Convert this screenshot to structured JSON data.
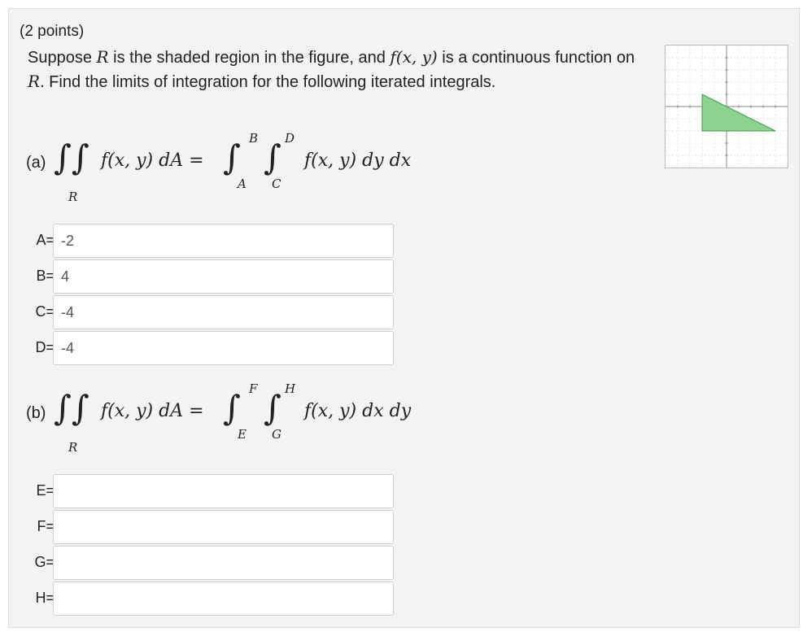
{
  "points": "(2 points)",
  "prompt": {
    "t1": "Suppose ",
    "r1": "R",
    "t2": " is the shaded region in the figure, and ",
    "fxy": "f(x, y)",
    "t3": " is a continuous function on ",
    "r2": "R",
    "t4": ". Find the limits of integration for the following iterated integrals."
  },
  "part_a": {
    "label": "(a)",
    "region": "R",
    "lhs": "f(x, y) dA =",
    "upper_outer": "B",
    "lower_outer": "A",
    "upper_inner": "D",
    "lower_inner": "C",
    "rhs": "f(x, y) dy dx",
    "fields": [
      {
        "label": "A=",
        "value": "-2"
      },
      {
        "label": "B=",
        "value": "4"
      },
      {
        "label": "C=",
        "value": "-4"
      },
      {
        "label": "D=",
        "value": "-4"
      }
    ]
  },
  "part_b": {
    "label": "(b)",
    "region": "R",
    "lhs": "f(x, y) dA =",
    "upper_outer": "F",
    "lower_outer": "E",
    "upper_inner": "H",
    "lower_inner": "G",
    "rhs": "f(x, y) dx dy",
    "fields": [
      {
        "label": "E=",
        "value": ""
      },
      {
        "label": "F=",
        "value": ""
      },
      {
        "label": "G=",
        "value": ""
      },
      {
        "label": "H=",
        "value": ""
      }
    ]
  },
  "figure": {
    "region_color": "#8fd18f",
    "region_stroke": "#3f9a3f",
    "vertices": [
      [
        -2,
        1
      ],
      [
        -2,
        -2
      ],
      [
        4,
        -2
      ]
    ],
    "axis_range": [
      -5,
      5
    ]
  }
}
